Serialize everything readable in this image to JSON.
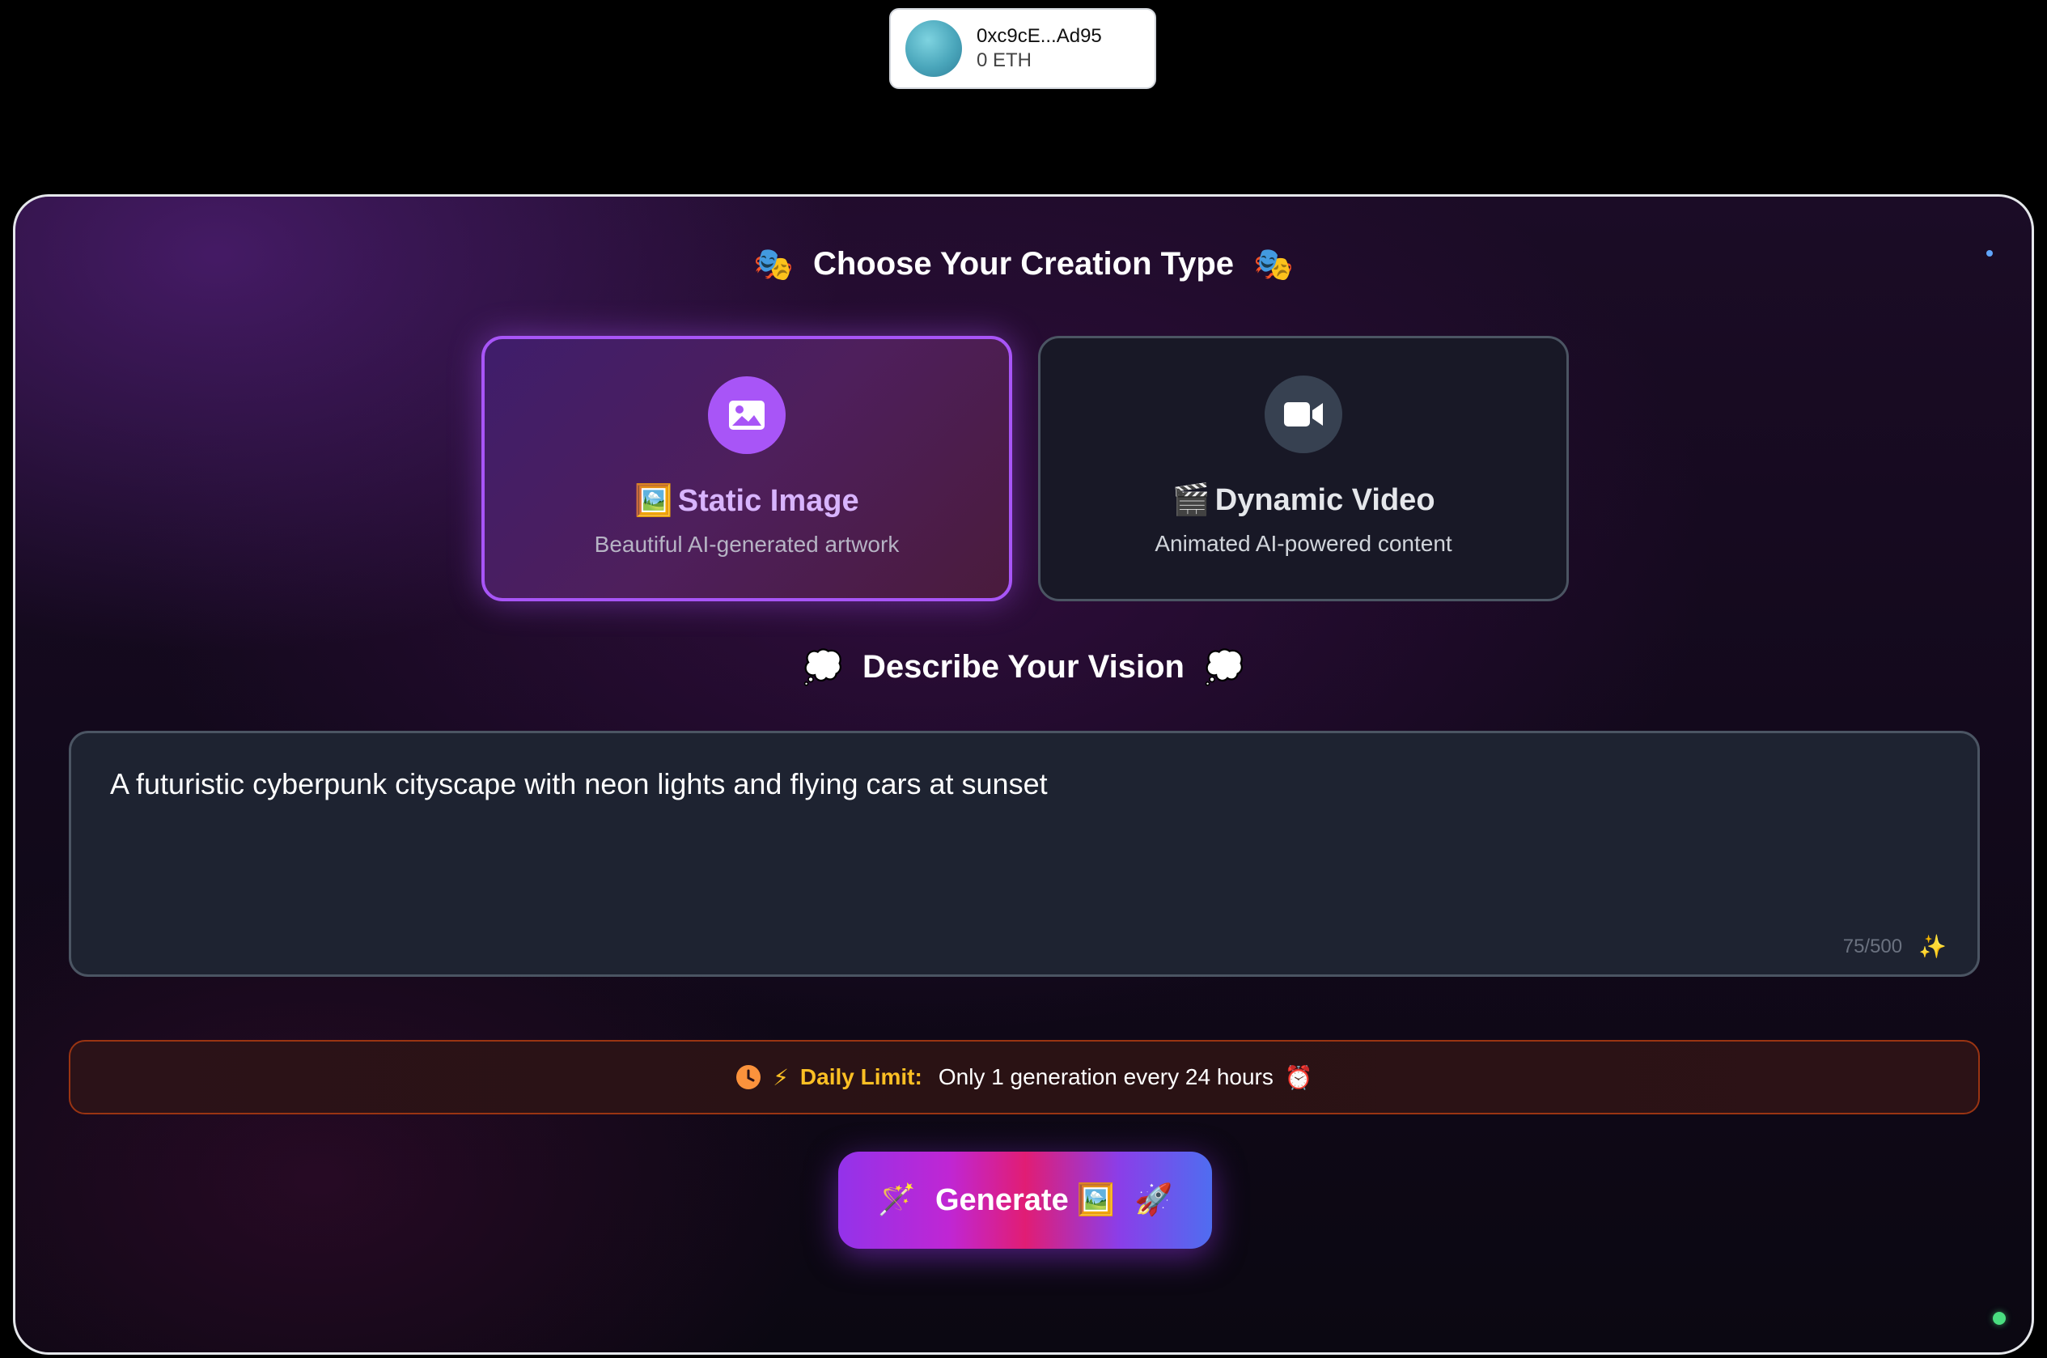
{
  "wallet": {
    "address": "0xc9cE...Ad95",
    "balance": "0 ETH"
  },
  "creation": {
    "title": "Choose Your Creation Type",
    "title_emoji": "🎭",
    "options": [
      {
        "emoji": "🖼️",
        "title": "Static Image",
        "description": "Beautiful AI-generated artwork",
        "icon": "image-icon",
        "selected": true
      },
      {
        "emoji": "🎬",
        "title": "Dynamic Video",
        "description": "Animated AI-powered content",
        "icon": "video-camera-icon",
        "selected": false
      }
    ]
  },
  "vision": {
    "title": "Describe Your Vision",
    "title_emoji": "💭",
    "prompt_value": "A futuristic cyberpunk cityscape with neon lights and flying cars at sunset",
    "counter": "75/500",
    "counter_emoji": "✨"
  },
  "limit": {
    "icon": "clock-icon",
    "bolt": "⚡",
    "label": "Daily Limit:",
    "text": "Only 1 generation every 24 hours",
    "end_emoji": "⏰"
  },
  "generate": {
    "wand_emoji": "🪄",
    "label": "Generate",
    "type_emoji": "🖼️",
    "rocket_emoji": "🚀"
  },
  "colors": {
    "accent_purple": "#a855f7",
    "status_green": "#4ade80",
    "status_blue": "#60a5fa",
    "warning_amber": "#fbbf24"
  }
}
